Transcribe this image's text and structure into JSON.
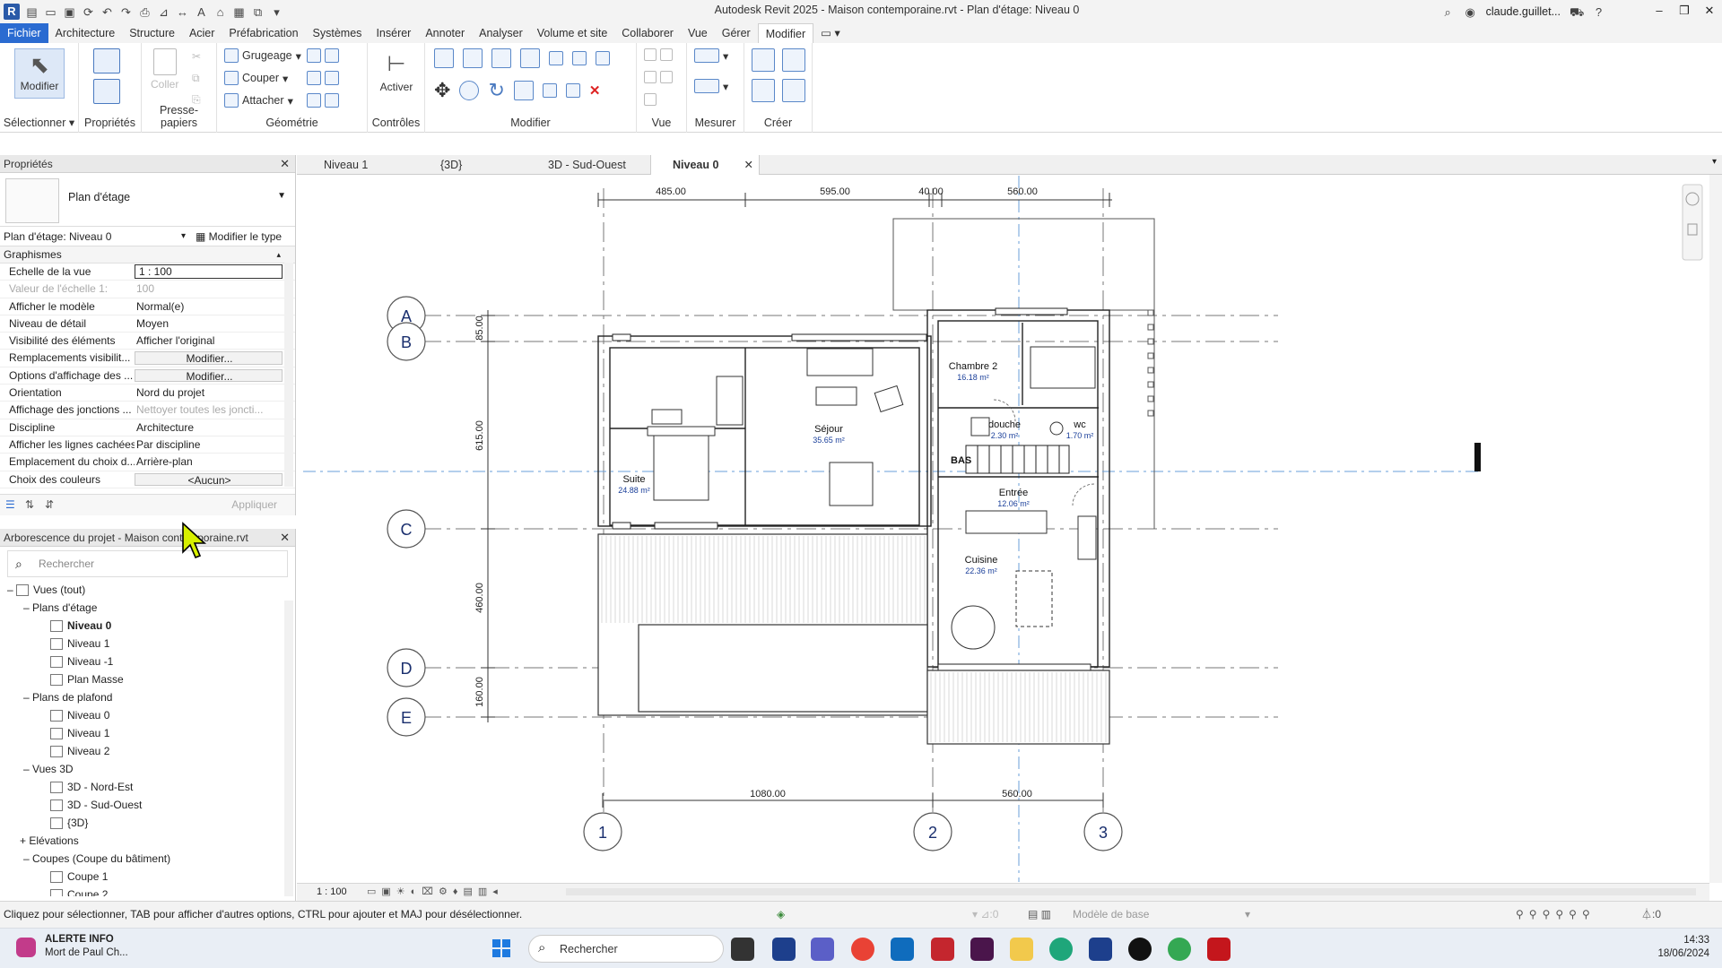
{
  "app": {
    "title": "Autodesk Revit 2025 - Maison contemporaine.rvt - Plan d'étage: Niveau 0",
    "user": "claude.guillet...",
    "logo": "R"
  },
  "menu": [
    "Fichier",
    "Architecture",
    "Structure",
    "Acier",
    "Préfabrication",
    "Systèmes",
    "Insérer",
    "Annoter",
    "Analyser",
    "Volume et site",
    "Collaborer",
    "Vue",
    "Gérer",
    "Modifier"
  ],
  "ribbon": {
    "modifier_btn": "Modifier",
    "coller_btn": "Coller",
    "activer_btn": "Activer",
    "grugeage": "Grugeage",
    "couper": "Couper",
    "attacher": "Attacher",
    "groups": {
      "selectionner": "Sélectionner",
      "proprietes": "Propriétés",
      "presse_papiers": "Presse-papiers",
      "geometrie": "Géométrie",
      "controles": "Contrôles",
      "modifier": "Modifier",
      "vue": "Vue",
      "mesurer": "Mesurer",
      "creer": "Créer"
    }
  },
  "properties": {
    "header": "Propriétés",
    "type_name": "Plan d'étage",
    "instance_selector": "Plan d'étage: Niveau 0",
    "edit_type": "Modifier le type",
    "section": "Graphismes",
    "apply": "Appliquer",
    "rows": [
      {
        "k": "Echelle de la vue",
        "v": "1 : 100"
      },
      {
        "k": "Valeur de l'échelle    1:",
        "v": "100"
      },
      {
        "k": "Afficher le modèle",
        "v": "Normal(e)"
      },
      {
        "k": "Niveau de détail",
        "v": "Moyen"
      },
      {
        "k": "Visibilité des éléments",
        "v": "Afficher l'original"
      },
      {
        "k": "Remplacements visibilit...",
        "v": "Modifier..."
      },
      {
        "k": "Options d'affichage des ...",
        "v": "Modifier..."
      },
      {
        "k": "Orientation",
        "v": "Nord du projet"
      },
      {
        "k": "Affichage des jonctions ...",
        "v": "Nettoyer toutes les joncti..."
      },
      {
        "k": "Discipline",
        "v": "Architecture"
      },
      {
        "k": "Afficher les lignes cachées",
        "v": "Par discipline"
      },
      {
        "k": "Emplacement du choix d...",
        "v": "Arrière-plan"
      },
      {
        "k": "Choix des couleurs",
        "v": "<Aucun>"
      }
    ]
  },
  "browser": {
    "header": "Arborescence du projet - Maison contemporaine.rvt",
    "search_placeholder": "Rechercher",
    "root": "Vues (tout)",
    "groups": [
      {
        "label": "Plans d'étage",
        "items": [
          "Niveau 0",
          "Niveau 1",
          "Niveau -1",
          "Plan Masse"
        ]
      },
      {
        "label": "Plans de plafond",
        "items": [
          "Niveau 0",
          "Niveau 1",
          "Niveau 2"
        ]
      },
      {
        "label": "Vues 3D",
        "items": [
          "3D - Nord-Est",
          "3D - Sud-Ouest",
          "{3D}"
        ]
      },
      {
        "label": "Elévations",
        "items": []
      },
      {
        "label": "Coupes (Coupe du bâtiment)",
        "items": [
          "Coupe 1",
          "Coupe 2"
        ]
      }
    ]
  },
  "tabs": [
    "Niveau 1",
    "{3D}",
    "3D - Sud-Ouest",
    "Niveau 0"
  ],
  "plan": {
    "grids": [
      "A",
      "B",
      "C",
      "D",
      "E",
      "1",
      "2",
      "3"
    ],
    "dims_top": [
      "485.00",
      "595.00",
      "40.00",
      "560.00"
    ],
    "dims_bottom": [
      "1080.00",
      "560.00"
    ],
    "dims_left": [
      "85.00",
      "615.00",
      "460.00",
      "160.00"
    ],
    "rooms": [
      {
        "name": "Chambre 2",
        "area": "16.18 m²"
      },
      {
        "name": "Séjour",
        "area": "35.65 m²"
      },
      {
        "name": "douche",
        "area": "2.30 m²"
      },
      {
        "name": "wc",
        "area": "1.70 m²"
      },
      {
        "name": "Suite",
        "area": "24.88 m²"
      },
      {
        "name": "Entrée",
        "area": "12.06 m²"
      },
      {
        "name": "Cuisine",
        "area": "22.36 m²"
      }
    ],
    "stair_label": "BAS"
  },
  "viewbar": {
    "scale": "1 : 100"
  },
  "status": {
    "hint": "Cliquez pour sélectionner, TAB pour afficher d'autres options, CTRL pour ajouter et MAJ pour désélectionner.",
    "model": "Modèle de base",
    "count0": ":0",
    "count_filter": ":0"
  },
  "taskbar": {
    "news_title": "ALERTE INFO",
    "news_sub": "Mort de Paul Ch...",
    "search": "Rechercher",
    "time": "14:33",
    "date": "18/06/2024"
  }
}
